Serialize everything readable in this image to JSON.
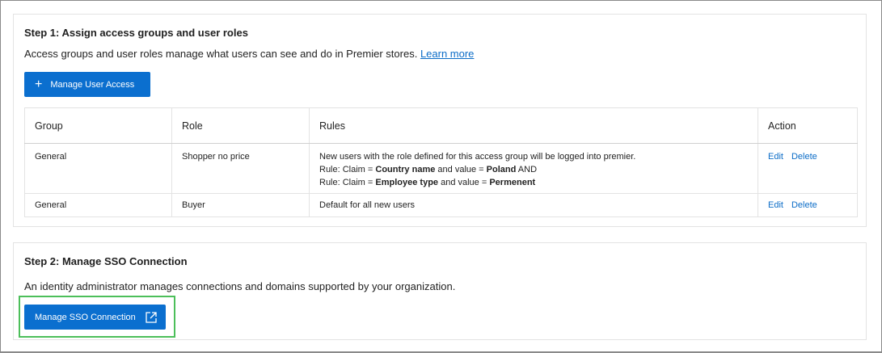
{
  "step1": {
    "title": "Step 1: Assign access groups and user roles",
    "description": "Access groups and user roles manage what users can see and do in Premier stores.",
    "learn_more": "Learn more",
    "button": "Manage User Access",
    "table": {
      "headers": [
        "Group",
        "Role",
        "Rules",
        "Action"
      ],
      "rows": [
        {
          "group": "General",
          "role": "Shopper no price",
          "rules": [
            {
              "text": "New users with the role defined for this access group will be logged into premier."
            },
            {
              "pre": "Rule: Claim = ",
              "b1": "Country name",
              "mid": " and value = ",
              "b2": "Poland",
              "post": " AND"
            },
            {
              "pre": "Rule: Claim = ",
              "b1": "Employee type",
              "mid": " and value = ",
              "b2": "Permenent",
              "post": ""
            }
          ],
          "edit": "Edit",
          "delete": "Delete"
        },
        {
          "group": "General",
          "role": "Buyer",
          "rules": [
            {
              "text": "Default for all new users"
            }
          ],
          "edit": "Edit",
          "delete": "Delete"
        }
      ]
    }
  },
  "step2": {
    "title": "Step 2: Manage SSO Connection",
    "description": "An identity administrator manages connections and domains supported by your organization.",
    "button": "Manage SSO Connection"
  },
  "colors": {
    "primary": "#0b6fcf",
    "highlight": "#4cbf5a"
  }
}
